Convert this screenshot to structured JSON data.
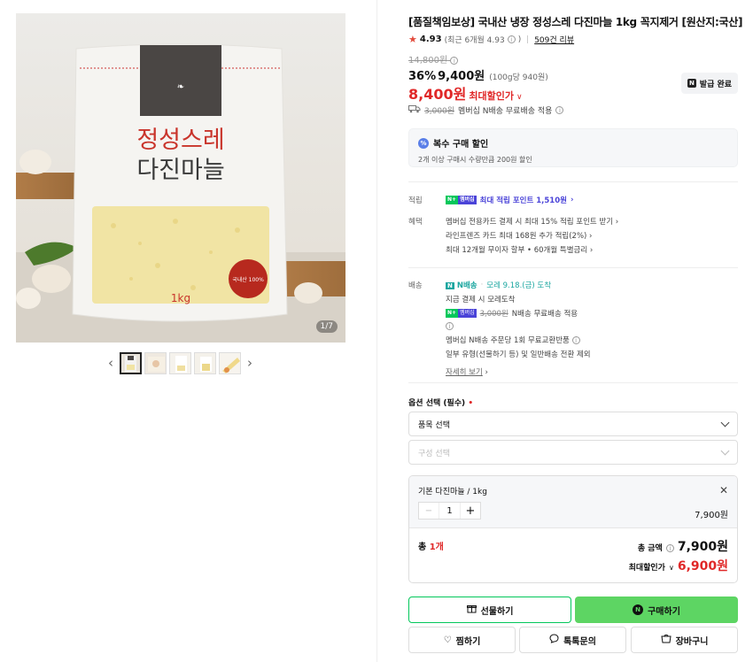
{
  "product": {
    "title": "[품질책임보상] 국내산 냉장 정성스레 다진마늘 1kg 꼭지제거 [원산지:국산]",
    "rating": "4.93",
    "rating_recent": "(최근 6개월 4.93",
    "rating_recent_close": ")",
    "review_count": "509건 리뷰",
    "original_price": "14,800원",
    "discount_rate": "36%",
    "sale_price": "9,400원",
    "unit_price": "(100g당 940원)",
    "max_discount_price": "8,400원",
    "max_discount_label": "최대할인가",
    "coupon_button": "발급 완료",
    "shipping_strike": "3,000원",
    "shipping_text": "멤버십 N배송 무료배송 적용"
  },
  "image": {
    "package_label_line1": "정성스레",
    "package_label_line2": "다진마늘",
    "package_weight": "1kg",
    "package_seal": "국내산 100%",
    "counter": "1/7"
  },
  "multi_discount": {
    "title": "복수 구매 할인",
    "subtitle": "2개 이상 구매시 수량만큼 200원 할인"
  },
  "benefits": {
    "point_label": "적립",
    "membership_badge": "멤버십",
    "point_text": "최대 적립 포인트 1,510원",
    "benefit_label": "혜택",
    "lines": [
      "멤버십 전용카드 결제 시 최대 15% 적립 포인트 받기",
      "라인프렌즈 카드 최대 168원 추가 적립(2%)",
      "최대 12개월 무이자 할부 • 60개월 특별금리"
    ]
  },
  "delivery": {
    "label": "배송",
    "arrival": "모레 9.18.(금) 도착",
    "brand": "N배송",
    "line1": "지금 결제 시 모레도착",
    "strike": "3,000원",
    "free_text": "N배송 무료배송 적용",
    "line3": "멤버십 N배송 주문당 1회 무료교환반품",
    "line4": "일부 유형(선물하기 등) 및 일반배송 전환 제외",
    "more": "자세히 보기"
  },
  "options": {
    "label": "옵션 선택 (필수)",
    "required_mark": "•",
    "select1": "품목 선택",
    "select2": "구성 선택"
  },
  "cart": {
    "item_name": "기본 다진마늘 / 1kg",
    "qty": "1",
    "item_price": "7,900원",
    "total_prefix": "총",
    "total_count": "1개",
    "total_label": "총 금액",
    "total_price": "7,900원",
    "max_label": "최대할인가",
    "max_price": "6,900원"
  },
  "buttons": {
    "gift": "선물하기",
    "buy": "구매하기",
    "wish": "찜하기",
    "talk": "톡톡문의",
    "cart": "장바구니"
  },
  "colors": {
    "accent_green": "#03c75a",
    "buy_button": "#5dd563",
    "price_red": "#e02828",
    "point_purple": "#4a43d8"
  }
}
